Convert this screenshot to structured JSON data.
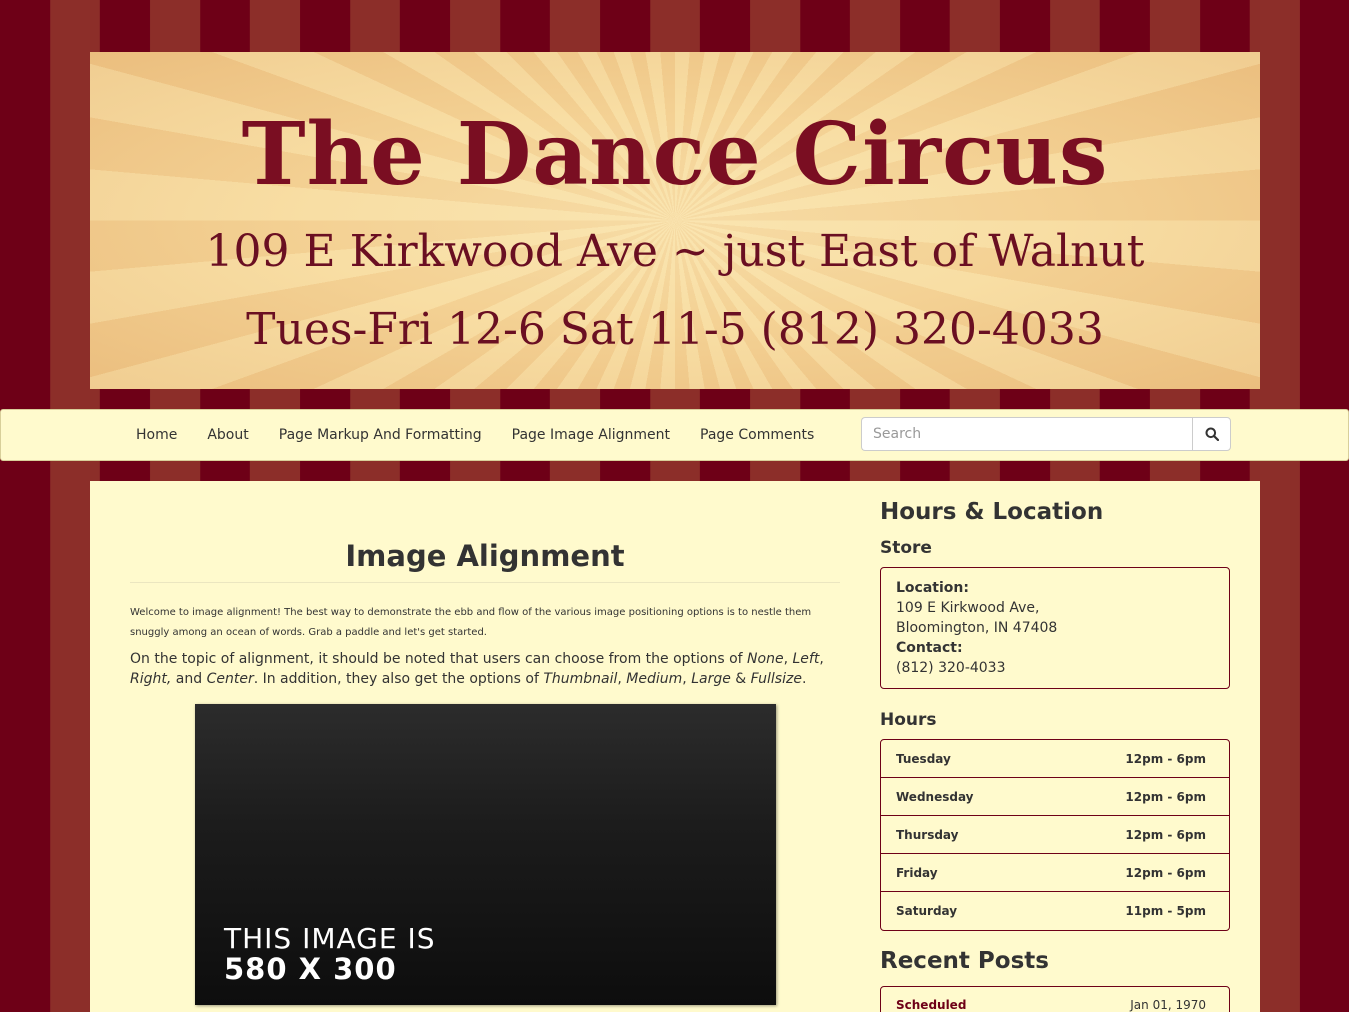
{
  "banner": {
    "title": "The Dance Circus",
    "address_line": "109 E Kirkwood Ave ~ just East of Walnut",
    "hours_line": "Tues-Fri 12-6 Sat 11-5 (812) 320-4033"
  },
  "nav": {
    "items": [
      {
        "label": "Home"
      },
      {
        "label": "About"
      },
      {
        "label": "Page Markup And Formatting"
      },
      {
        "label": "Page Image Alignment"
      },
      {
        "label": "Page Comments"
      }
    ],
    "search_placeholder": "Search",
    "search_icon": "search-icon"
  },
  "main": {
    "title": "Image Alignment",
    "intro": "Welcome to image alignment! The best way to demonstrate the ebb and flow of the various image positioning options is to nestle them snuggly among an ocean of words. Grab a paddle and let's get started.",
    "para_1": "On the topic of alignment, it should be noted that users can choose from the options of ",
    "opt_none": "None",
    "sep_1": ", ",
    "opt_left": "Left",
    "sep_2": ", ",
    "opt_right": "Right,",
    "para_2": " and ",
    "opt_center": "Center",
    "para_3": ". In addition, they also get the options of ",
    "opt_thumb": "Thumbnail",
    "sep_3": ", ",
    "opt_medium": "Medium",
    "sep_4": ", ",
    "opt_large": "Large",
    "para_4": " & ",
    "opt_full": "Fullsize",
    "para_5": ".",
    "image_text_1": "THIS IMAGE IS",
    "image_text_2": "580 X 300"
  },
  "sidebar": {
    "hours_location_title": "Hours & Location",
    "store_title": "Store",
    "location_label": "Location:",
    "address_1": "109 E Kirkwood Ave,",
    "address_2": "Bloomington, IN 47408",
    "contact_label": "Contact:",
    "phone": "(812) 320-4033",
    "hours_title": "Hours",
    "hours": [
      {
        "day": "Tuesday",
        "time": "12pm - 6pm"
      },
      {
        "day": "Wednesday",
        "time": "12pm - 6pm"
      },
      {
        "day": "Thursday",
        "time": "12pm - 6pm"
      },
      {
        "day": "Friday",
        "time": "12pm - 6pm"
      },
      {
        "day": "Saturday",
        "time": "11pm - 5pm"
      }
    ],
    "recent_posts_title": "Recent Posts",
    "recent_posts": [
      {
        "title": "Scheduled",
        "date": "Jan 01, 1970"
      }
    ]
  },
  "colors": {
    "stripe_dark": "#6e0017",
    "stripe_light": "#8c2e29",
    "panel_bg": "#fffacd",
    "brand_text": "#7a0e22"
  }
}
